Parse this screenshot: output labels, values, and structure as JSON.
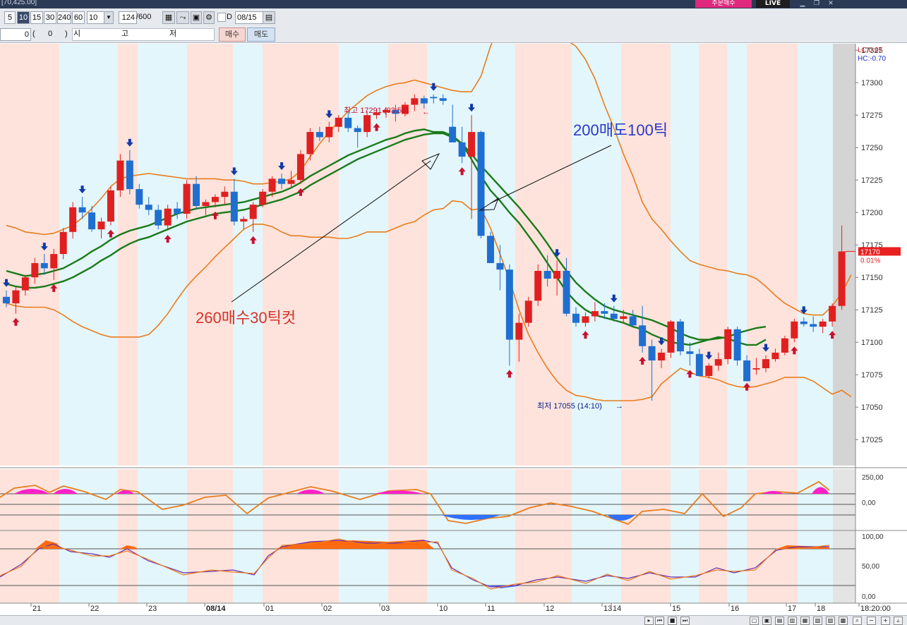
{
  "window": {
    "title": "[70,425.00]",
    "buy_button": "주문매수",
    "live_label": "LIVE"
  },
  "toolbar": {
    "intervals": [
      "5",
      "10",
      "15",
      "30",
      "240",
      "60"
    ],
    "selected_interval": "10",
    "interval_select_value": "10",
    "count_value": "124",
    "count_total": "/600",
    "checkbox_label": "D",
    "date_value": "08/15"
  },
  "toolbar2": {
    "qty_value": "0",
    "open_paren": "(",
    "qty2_value": "0",
    "close_paren": ")",
    "col_labels": [
      "시",
      "고",
      "저"
    ],
    "buy_label": "매수",
    "sell_label": "매도"
  },
  "colors": {
    "up": "#e02020",
    "down": "#1f6fd0",
    "band": "#e87d1e",
    "ma": "#1a7a1a",
    "bg_pink": "#fde3dc",
    "bg_blue": "#e3f6fb",
    "oscillator_pos": "#ff20c8",
    "oscillator_neg": "#3070ff",
    "stoch_fill": "#ff6a10"
  },
  "chart_data": [
    {
      "type": "candlestick",
      "y_ticks": [
        17025,
        17050,
        17075,
        17100,
        17125,
        17150,
        17175,
        17200,
        17225,
        17250,
        17275,
        17300,
        17325
      ],
      "ylim": [
        17005,
        17330
      ],
      "x_labels": [
        "21",
        "22",
        "23",
        "08/14",
        "01",
        "02",
        "03",
        "10",
        "11",
        "12",
        "13",
        "14",
        "15",
        "16",
        "17",
        "18",
        "18:20:00"
      ],
      "corner_labels": [
        "LC:0.67",
        "HC:-0.70"
      ],
      "current_price": "17170",
      "current_change": "0.01%",
      "annotations": {
        "high": "최고 17291 (03:50)",
        "low": "최저 17055 (14:10)",
        "buy_note": "260매수30틱컷",
        "sell_note": "200매도100틱"
      },
      "candles": [
        [
          17135,
          17140,
          17127,
          17130
        ],
        [
          17130,
          17143,
          17122,
          17140
        ],
        [
          17140,
          17152,
          17136,
          17150
        ],
        [
          17150,
          17165,
          17145,
          17161
        ],
        [
          17161,
          17168,
          17152,
          17157
        ],
        [
          17157,
          17172,
          17148,
          17168
        ],
        [
          17168,
          17188,
          17164,
          17185
        ],
        [
          17185,
          17208,
          17180,
          17204
        ],
        [
          17204,
          17212,
          17195,
          17200
        ],
        [
          17200,
          17205,
          17185,
          17187
        ],
        [
          17187,
          17196,
          17180,
          17193
        ],
        [
          17193,
          17220,
          17190,
          17217
        ],
        [
          17217,
          17245,
          17212,
          17240
        ],
        [
          17240,
          17248,
          17214,
          17218
        ],
        [
          17218,
          17222,
          17203,
          17206
        ],
        [
          17206,
          17212,
          17198,
          17202
        ],
        [
          17202,
          17206,
          17187,
          17190
        ],
        [
          17190,
          17206,
          17186,
          17203
        ],
        [
          17203,
          17208,
          17195,
          17199
        ],
        [
          17199,
          17225,
          17195,
          17222
        ],
        [
          17222,
          17228,
          17202,
          17205
        ],
        [
          17205,
          17210,
          17198,
          17208
        ],
        [
          17208,
          17214,
          17204,
          17212
        ],
        [
          17212,
          17220,
          17206,
          17216
        ],
        [
          17216,
          17226,
          17190,
          17193
        ],
        [
          17193,
          17197,
          17187,
          17195
        ],
        [
          17195,
          17208,
          17185,
          17206
        ],
        [
          17206,
          17218,
          17204,
          17216
        ],
        [
          17216,
          17228,
          17212,
          17226
        ],
        [
          17226,
          17230,
          17218,
          17222
        ],
        [
          17222,
          17232,
          17219,
          17225
        ],
        [
          17225,
          17248,
          17222,
          17245
        ],
        [
          17245,
          17265,
          17240,
          17262
        ],
        [
          17262,
          17266,
          17255,
          17258
        ],
        [
          17258,
          17270,
          17254,
          17266
        ],
        [
          17266,
          17275,
          17262,
          17273
        ],
        [
          17273,
          17278,
          17262,
          17265
        ],
        [
          17265,
          17267,
          17250,
          17262
        ],
        [
          17262,
          17278,
          17258,
          17275
        ],
        [
          17275,
          17280,
          17272,
          17277
        ],
        [
          17277,
          17281,
          17273,
          17279
        ],
        [
          17279,
          17283,
          17270,
          17276
        ],
        [
          17276,
          17285,
          17274,
          17283
        ],
        [
          17283,
          17291,
          17278,
          17288
        ],
        [
          17288,
          17290,
          17280,
          17284
        ],
        [
          17289,
          17291,
          17284,
          17288
        ],
        [
          17288,
          17291,
          17283,
          17286
        ],
        [
          17266,
          17283,
          17257,
          17254
        ],
        [
          17254,
          17266,
          17238,
          17243
        ],
        [
          17243,
          17275,
          17195,
          17262
        ],
        [
          17262,
          17263,
          17180,
          17182
        ],
        [
          17182,
          17185,
          17162,
          17161
        ],
        [
          17161,
          17175,
          17140,
          17156
        ],
        [
          17156,
          17160,
          17082,
          17102
        ],
        [
          17102,
          17122,
          17085,
          17115
        ],
        [
          17115,
          17135,
          17112,
          17132
        ],
        [
          17132,
          17160,
          17128,
          17155
        ],
        [
          17155,
          17167,
          17143,
          17149
        ],
        [
          17149,
          17163,
          17136,
          17155
        ],
        [
          17155,
          17165,
          17120,
          17122
        ],
        [
          17122,
          17127,
          17112,
          17115
        ],
        [
          17115,
          17123,
          17112,
          17120
        ],
        [
          17120,
          17131,
          17116,
          17124
        ],
        [
          17124,
          17130,
          17118,
          17122
        ],
        [
          17122,
          17128,
          17116,
          17118
        ],
        [
          17118,
          17125,
          17115,
          17120
        ],
        [
          17120,
          17125,
          17112,
          17113
        ],
        [
          17113,
          17128,
          17092,
          17097
        ],
        [
          17097,
          17102,
          17055,
          17086
        ],
        [
          17086,
          17095,
          17080,
          17092
        ],
        [
          17092,
          17117,
          17088,
          17116
        ],
        [
          17116,
          17118,
          17090,
          17093
        ],
        [
          17093,
          17100,
          17082,
          17091
        ],
        [
          17091,
          17095,
          17075,
          17074
        ],
        [
          17074,
          17084,
          17072,
          17082
        ],
        [
          17082,
          17092,
          17078,
          17087
        ],
        [
          17087,
          17112,
          17083,
          17110
        ],
        [
          17110,
          17112,
          17082,
          17086
        ],
        [
          17086,
          17090,
          17072,
          17070
        ],
        [
          17079,
          17088,
          17075,
          17080
        ],
        [
          17080,
          17090,
          17077,
          17087
        ],
        [
          17087,
          17095,
          17085,
          17092
        ],
        [
          17092,
          17105,
          17090,
          17103
        ],
        [
          17103,
          17118,
          17100,
          17116
        ],
        [
          17116,
          17119,
          17112,
          17114
        ],
        [
          17114,
          17120,
          17108,
          17112
        ],
        [
          17112,
          17118,
          17107,
          17116
        ],
        [
          17116,
          17130,
          17112,
          17128
        ],
        [
          17128,
          17190,
          17125,
          17170
        ]
      ],
      "upper_band": [
        17190,
        17188,
        17185,
        17184,
        17183,
        17184,
        17187,
        17190,
        17196,
        17203,
        17211,
        17220,
        17226,
        17228,
        17229,
        17230,
        17229,
        17228,
        17227,
        17226,
        17226,
        17226,
        17226,
        17225,
        17225,
        17224,
        17222,
        17222,
        17223,
        17224,
        17226,
        17232,
        17243,
        17253,
        17262,
        17270,
        17278,
        17284,
        17290,
        17294,
        17297,
        17299,
        17300,
        17302,
        17300,
        17298,
        17296,
        17294,
        17293,
        17293,
        17305,
        17328,
        17345,
        17345,
        17340,
        17338,
        17338,
        17337,
        17335,
        17333,
        17328,
        17318,
        17303,
        17283,
        17265,
        17245,
        17228,
        17208,
        17195,
        17187,
        17178,
        17170,
        17163,
        17160,
        17158,
        17156,
        17155,
        17153,
        17152,
        17149,
        17143,
        17136,
        17130,
        17126,
        17122,
        17121,
        17121,
        17128,
        17138,
        17152
      ],
      "lower_band": [
        17130,
        17128,
        17127,
        17127,
        17127,
        17125,
        17121,
        17116,
        17112,
        17109,
        17106,
        17104,
        17104,
        17104,
        17104,
        17106,
        17113,
        17122,
        17133,
        17143,
        17151,
        17158,
        17166,
        17173,
        17180,
        17187,
        17191,
        17191,
        17189,
        17185,
        17182,
        17182,
        17181,
        17181,
        17181,
        17180,
        17180,
        17182,
        17185,
        17185,
        17185,
        17188,
        17191,
        17193,
        17198,
        17202,
        17203,
        17209,
        17208,
        17202,
        17203,
        17188,
        17168,
        17148,
        17125,
        17106,
        17092,
        17080,
        17070,
        17063,
        17059,
        17058,
        17056,
        17055,
        17055,
        17055,
        17055,
        17056,
        17058,
        17068,
        17074,
        17080,
        17077,
        17074,
        17073,
        17071,
        17068,
        17066,
        17065,
        17066,
        17068,
        17070,
        17073,
        17073,
        17073,
        17070,
        17065,
        17060,
        17063,
        17058
      ],
      "ma_fast": [
        17155,
        17153,
        17151,
        17152,
        17153,
        17155,
        17157,
        17161,
        17165,
        17170,
        17174,
        17179,
        17183,
        17186,
        17188,
        17190,
        17193,
        17196,
        17199,
        17201,
        17203,
        17204,
        17205,
        17206,
        17207,
        17208,
        17210,
        17212,
        17214,
        17216,
        17219,
        17223,
        17228,
        17232,
        17236,
        17240,
        17244,
        17247,
        17250,
        17253,
        17256,
        17258,
        17261,
        17263,
        17264,
        17262,
        17262,
        17259,
        17253,
        17241,
        17228,
        17217,
        17209,
        17200,
        17192,
        17182,
        17172,
        17161,
        17150,
        17139,
        17131,
        17125,
        17121,
        17119,
        17117,
        17115,
        17112,
        17110,
        17106,
        17103,
        17100,
        17099,
        17098,
        17100,
        17102,
        17104,
        17103,
        17100,
        17098,
        17098,
        17102
      ],
      "ma_slow": [
        17145,
        17143,
        17142,
        17142,
        17143,
        17145,
        17147,
        17150,
        17154,
        17158,
        17163,
        17167,
        17172,
        17176,
        17179,
        17181,
        17184,
        17187,
        17190,
        17193,
        17195,
        17197,
        17199,
        17200,
        17201,
        17202,
        17204,
        17206,
        17208,
        17210,
        17213,
        17216,
        17221,
        17225,
        17229,
        17233,
        17237,
        17241,
        17244,
        17247,
        17250,
        17253,
        17256,
        17258,
        17260,
        17261,
        17261,
        17258,
        17253,
        17245,
        17236,
        17228,
        17220,
        17212,
        17204,
        17195,
        17186,
        17176,
        17165,
        17155,
        17146,
        17139,
        17133,
        17128,
        17125,
        17123,
        17121,
        17119,
        17117,
        17114,
        17111,
        17107,
        17104,
        17102,
        17102,
        17103,
        17104,
        17107,
        17109,
        17111,
        17112
      ]
    },
    {
      "type": "area",
      "name": "oscillator",
      "y_ticks": [
        "250,00",
        "0,00"
      ]
    },
    {
      "type": "line",
      "name": "stochastic",
      "y_ticks": [
        "100,00",
        "50,00",
        "0,00"
      ]
    }
  ]
}
